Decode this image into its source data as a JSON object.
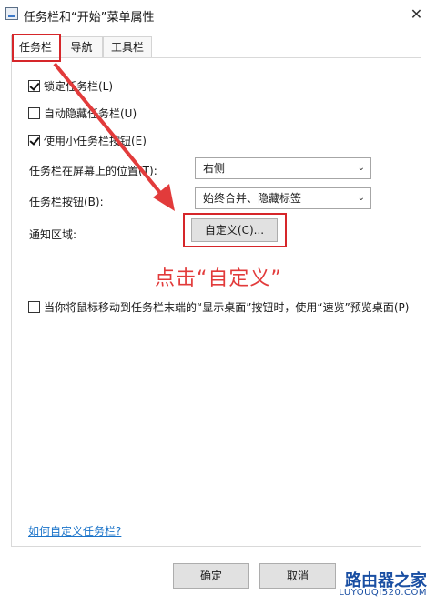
{
  "window": {
    "title": "任务栏和“开始”菜单属性",
    "close_glyph": "✕"
  },
  "tabs": [
    {
      "label": "任务栏"
    },
    {
      "label": "导航"
    },
    {
      "label": "工具栏"
    }
  ],
  "options": {
    "lock_taskbar": {
      "label": "锁定任务栏(L)",
      "checked": true
    },
    "autohide": {
      "label": "自动隐藏任务栏(U)",
      "checked": false
    },
    "small_buttons": {
      "label": "使用小任务栏按钮(E)",
      "checked": true
    },
    "position": {
      "label": "任务栏在屏幕上的位置(T):",
      "value": "右侧"
    },
    "buttons": {
      "label": "任务栏按钮(B):",
      "value": "始终合并、隐藏标签"
    },
    "notification": {
      "label": "通知区域:",
      "button_label": "自定义(C)..."
    },
    "peek": {
      "label": "当你将鼠标移动到任务栏末端的“显示桌面”按钮时，使用“速览”预览桌面(P)",
      "checked": false
    }
  },
  "help_link": "如何自定义任务栏?",
  "footer": {
    "ok_label": "确定",
    "cancel_label": "取消"
  },
  "annotation": {
    "text": "点击“自定义”",
    "color": "#e23b3b"
  },
  "watermark": {
    "brand": "路由器之家",
    "url": "LUYOUQI520.COM"
  },
  "colors": {
    "highlight": "#d6262a",
    "link": "#1a73c9",
    "watermark": "#1a4fa3"
  },
  "icons": {
    "app": "taskbar-properties-icon",
    "dropdown": "chevron-down-icon",
    "check": "checkmark-icon"
  }
}
